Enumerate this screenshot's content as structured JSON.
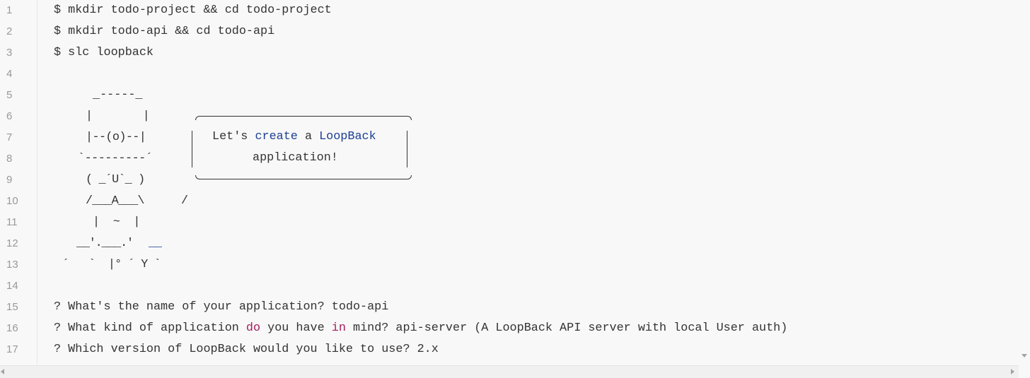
{
  "editor": {
    "line_numbers": [
      "1",
      "2",
      "3",
      "4",
      "5",
      "6",
      "7",
      "8",
      "9",
      "10",
      "11",
      "12",
      "13",
      "14",
      "15",
      "16",
      "17"
    ],
    "commands": {
      "l1": "$ mkdir todo-project && cd todo-project",
      "l2": "$ mkdir todo-api && cd todo-api",
      "l3": "$ slc loopback"
    },
    "ascii_art": {
      "l5": "_-----_",
      "l6": "|       |",
      "l7": "|--(o)--|",
      "l8": "`---------´",
      "l9": "( _´U`_ )",
      "l10_body": "/___A___\\",
      "l10_slash": "/",
      "l11": "|  ~  |",
      "l12_a": "__'.___.'",
      "l12_b": "__",
      "l13": "´   `  |° ´ Y `"
    },
    "greeting": {
      "line1_a": "Let's ",
      "line1_create": "create",
      "line1_b": " a ",
      "line1_loopback": "LoopBack",
      "line2": "application!"
    },
    "prompts": {
      "l15": "? What's the name of your application? todo-api",
      "l16_a": "? What kind of application ",
      "l16_do": "do",
      "l16_b": " you have ",
      "l16_in": "in",
      "l16_c": " mind? api-server (A LoopBack API server with local User auth)",
      "l17": "? Which version of LoopBack would you like to use? 2.x"
    }
  },
  "colors": {
    "background": "#f8f8f8",
    "text": "#333333",
    "line_number": "#999999",
    "keyword": "#a71d5d",
    "identifier": "#1c3f94"
  },
  "icons": {
    "scroll_left": "triangle-left",
    "scroll_right": "triangle-right",
    "scroll_down": "triangle-down"
  }
}
